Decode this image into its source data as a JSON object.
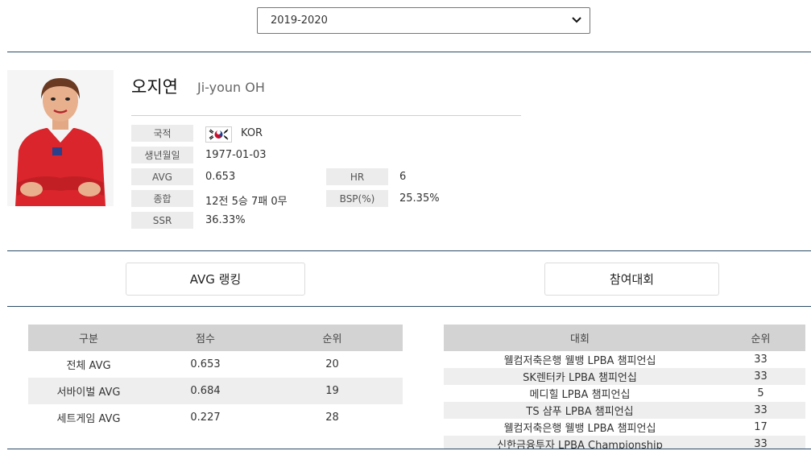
{
  "season": {
    "selected": "2019-2020"
  },
  "player": {
    "name_ko": "오지연",
    "name_en": "Ji-youn OH"
  },
  "profile": {
    "nationality_label": "국적",
    "nationality": "KOR",
    "birth_label": "생년월일",
    "birth": "1977-01-03",
    "avg_label": "AVG",
    "avg": "0.653",
    "hr_label": "HR",
    "hr": "6",
    "record_label": "종합",
    "record": "12전 5승 7패 0무",
    "bsp_label": "BSP(%)",
    "bsp": "25.35%",
    "ssr_label": "SSR",
    "ssr": "36.33%"
  },
  "tabs": {
    "avg_ranking": "AVG 랭킹",
    "tournaments": "참여대회"
  },
  "ranking_table": {
    "headers": [
      "구분",
      "점수",
      "순위"
    ],
    "rows": [
      [
        "전체 AVG",
        "0.653",
        "20"
      ],
      [
        "서바이벌 AVG",
        "0.684",
        "19"
      ],
      [
        "세트게임 AVG",
        "0.227",
        "28"
      ]
    ]
  },
  "tournament_table": {
    "headers": [
      "대회",
      "순위"
    ],
    "rows": [
      [
        "웰컴저축은행 웰뱅 LPBA 챔피언십",
        "33"
      ],
      [
        "SK렌터카 LPBA 챔피언십",
        "33"
      ],
      [
        "메디힐 LPBA 챔피언십",
        "5"
      ],
      [
        "TS 샴푸 LPBA 챔피언십",
        "33"
      ],
      [
        "웰컴저축은행 웰뱅 LPBA 챔피언십",
        "17"
      ],
      [
        "신한금융투자 LPBA Championship",
        "33"
      ]
    ]
  },
  "colors": {
    "divider": "#2b4a66",
    "label_bg": "#ececec",
    "table_head_bg": "#d3d3d3"
  }
}
